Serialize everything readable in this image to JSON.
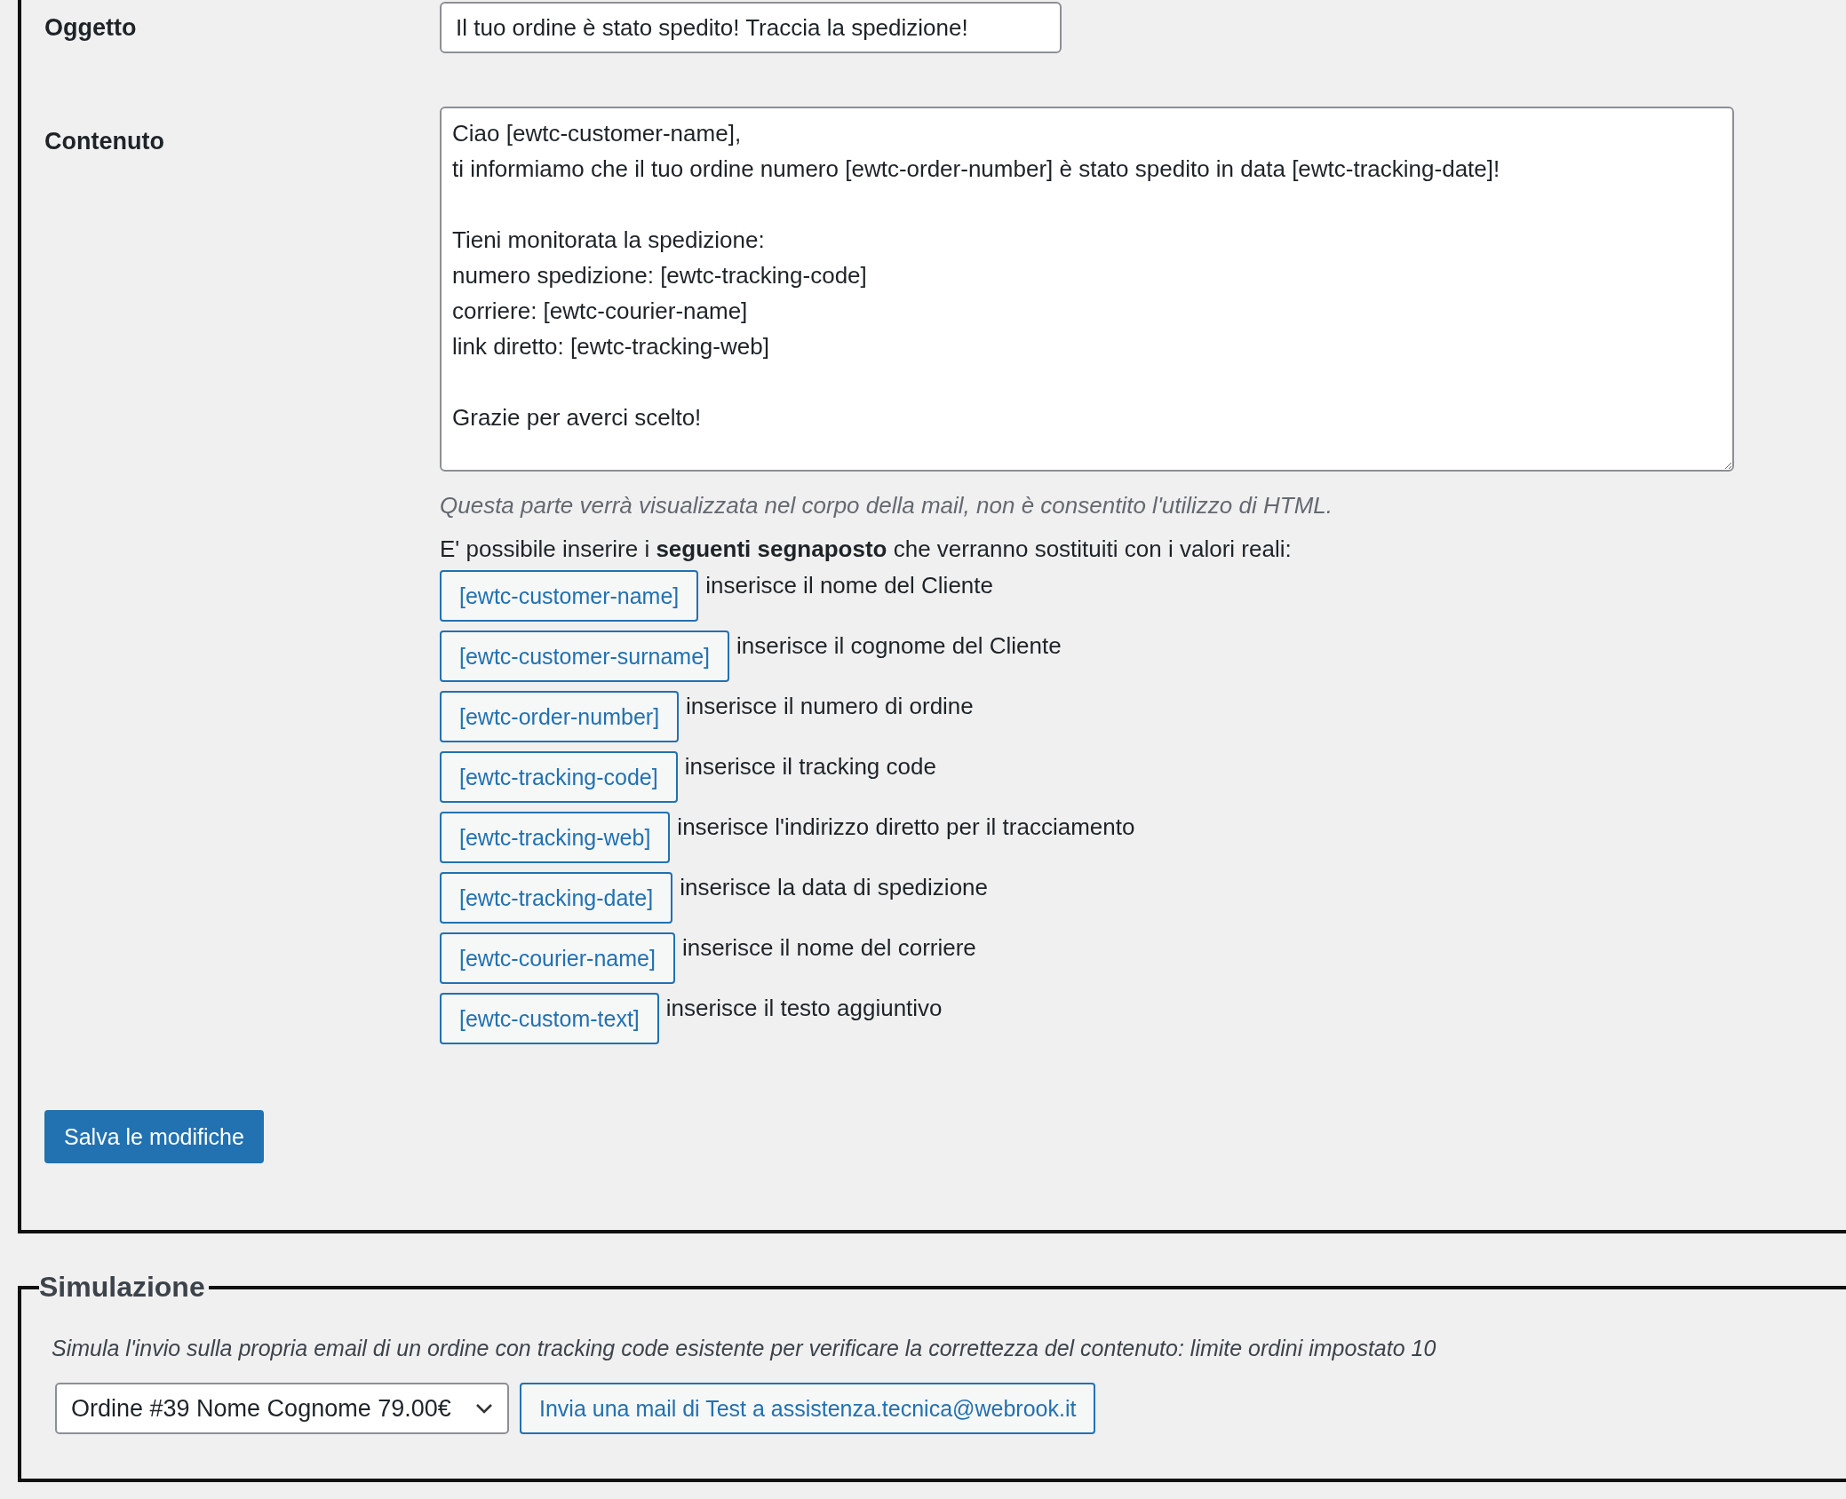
{
  "settings": {
    "subject": {
      "label": "Oggetto",
      "value": "Il tuo ordine è stato spedito! Traccia la spedizione!"
    },
    "content": {
      "label": "Contenuto",
      "value": "Ciao [ewtc-customer-name],\nti informiamo che il tuo ordine numero [ewtc-order-number] è stato spedito in data [ewtc-tracking-date]!\n\nTieni monitorata la spedizione:\nnumero spedizione: [ewtc-tracking-code]\ncorriere: [ewtc-courier-name]\nlink diretto: [ewtc-tracking-web]\n\nGrazie per averci scelto!",
      "description": "Questa parte verrà visualizzata nel corpo della mail, non è consentito l'utilizzo di HTML.",
      "placeholders_intro": "E' possibile inserire i **seguenti segnaposto** che verranno sostituiti con i valori reali:"
    },
    "placeholders": [
      {
        "tag": "[ewtc-customer-name]",
        "description": "inserisce il nome del Cliente"
      },
      {
        "tag": "[ewtc-customer-surname]",
        "description": "inserisce il cognome del Cliente"
      },
      {
        "tag": "[ewtc-order-number]",
        "description": "inserisce il numero di ordine"
      },
      {
        "tag": "[ewtc-tracking-code]",
        "description": "inserisce il tracking code"
      },
      {
        "tag": "[ewtc-tracking-web]",
        "description": "inserisce l'indirizzo diretto per il tracciamento"
      },
      {
        "tag": "[ewtc-tracking-date]",
        "description": "inserisce la data di spedizione"
      },
      {
        "tag": "[ewtc-courier-name]",
        "description": "inserisce il nome del corriere"
      },
      {
        "tag": "[ewtc-custom-text]",
        "description": "inserisce il testo aggiuntivo"
      }
    ],
    "save_button": "Salva le modifiche"
  },
  "simulation": {
    "title": "Simulazione",
    "description": "Simula l'invio sulla propria email di un ordine con tracking code esistente per verificare la correttezza del contenuto: limite ordini impostato 10",
    "order_select": "Ordine #39 Nome Cognome 79.00€",
    "test_button": "Invia una mail di Test a assistenza.tecnica@webrook.it"
  }
}
